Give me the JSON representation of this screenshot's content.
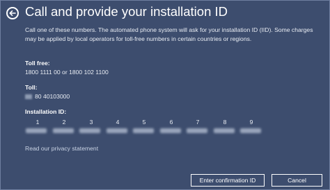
{
  "header": {
    "title": "Call and provide your installation ID"
  },
  "description": "Call one of these numbers. The automated phone system will ask for your installation ID (IID). Some charges may be applied by local operators for toll-free numbers in certain countries or regions.",
  "toll_free": {
    "label": "Toll free:",
    "value": "1800 1111 00 or 1800 102 1100"
  },
  "toll": {
    "label": "Toll:",
    "value": "80 40103000"
  },
  "installation_id": {
    "label": "Installation ID:",
    "group_numbers": [
      "1",
      "2",
      "3",
      "4",
      "5",
      "6",
      "7",
      "8",
      "9"
    ]
  },
  "links": {
    "privacy": "Read our privacy statement"
  },
  "buttons": {
    "confirm": "Enter confirmation ID",
    "cancel": "Cancel"
  },
  "icons": {
    "back": "back-arrow-icon"
  },
  "colors": {
    "background": "#3d4d6e",
    "text": "#ffffff"
  }
}
